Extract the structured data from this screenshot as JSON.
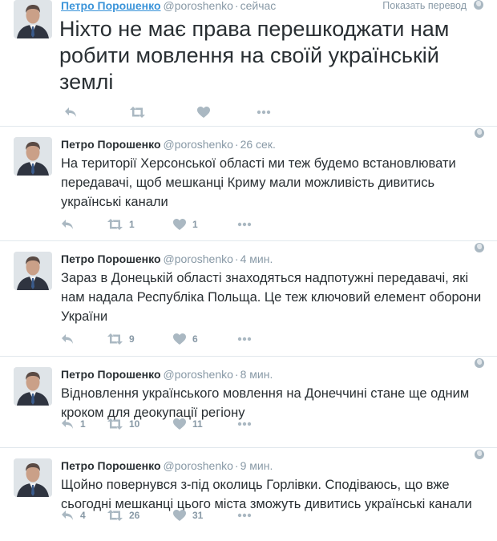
{
  "tweets": [
    {
      "name": "Петро Порошенко",
      "handle": "@poroshenko",
      "time": "сейчас",
      "translate_label": "Показать перевод",
      "text": "Ніхто не має права перешкоджати нам робити мовлення на своїй українській землі",
      "reply_count": "",
      "retweet_count": "",
      "like_count": ""
    },
    {
      "name": "Петро Порошенко",
      "handle": "@poroshenko",
      "time": "26 сек.",
      "text": "На території Херсонської області ми теж будемо встановлювати передавачі, щоб мешканці Криму мали можливість дивитись українські канали",
      "reply_count": "",
      "retweet_count": "1",
      "like_count": "1"
    },
    {
      "name": "Петро Порошенко",
      "handle": "@poroshenko",
      "time": "4 мин.",
      "text": "Зараз в Донецькій області знаходяться надпотужні передавачі, які нам надала Республіка Польща. Це теж ключовий елемент оборони України",
      "reply_count": "",
      "retweet_count": "9",
      "like_count": "6"
    },
    {
      "name": "Петро Порошенко",
      "handle": "@poroshenko",
      "time": "8 мин.",
      "text": "Відновлення українського мовлення на Донеччині стане ще одним кроком для деокупації регіону",
      "reply_count": "1",
      "retweet_count": "10",
      "like_count": "11"
    },
    {
      "name": "Петро Порошенко",
      "handle": "@poroshenko",
      "time": "9 мин.",
      "text": "Щойно повернувся з-під околиць Горлівки. Сподіваюсь, що вже сьогодні мешканці цього міста зможуть дивитись українські канали",
      "reply_count": "4",
      "retweet_count": "26",
      "like_count": "31"
    }
  ],
  "icons": {
    "reply": "reply-icon",
    "retweet": "retweet-icon",
    "like": "heart-icon",
    "more": "more-icon",
    "globe": "globe-icon"
  },
  "colors": {
    "link": "#3b94d9",
    "muted": "#8899a6",
    "icon": "#aab8c2",
    "divider": "#e1e8ed"
  }
}
